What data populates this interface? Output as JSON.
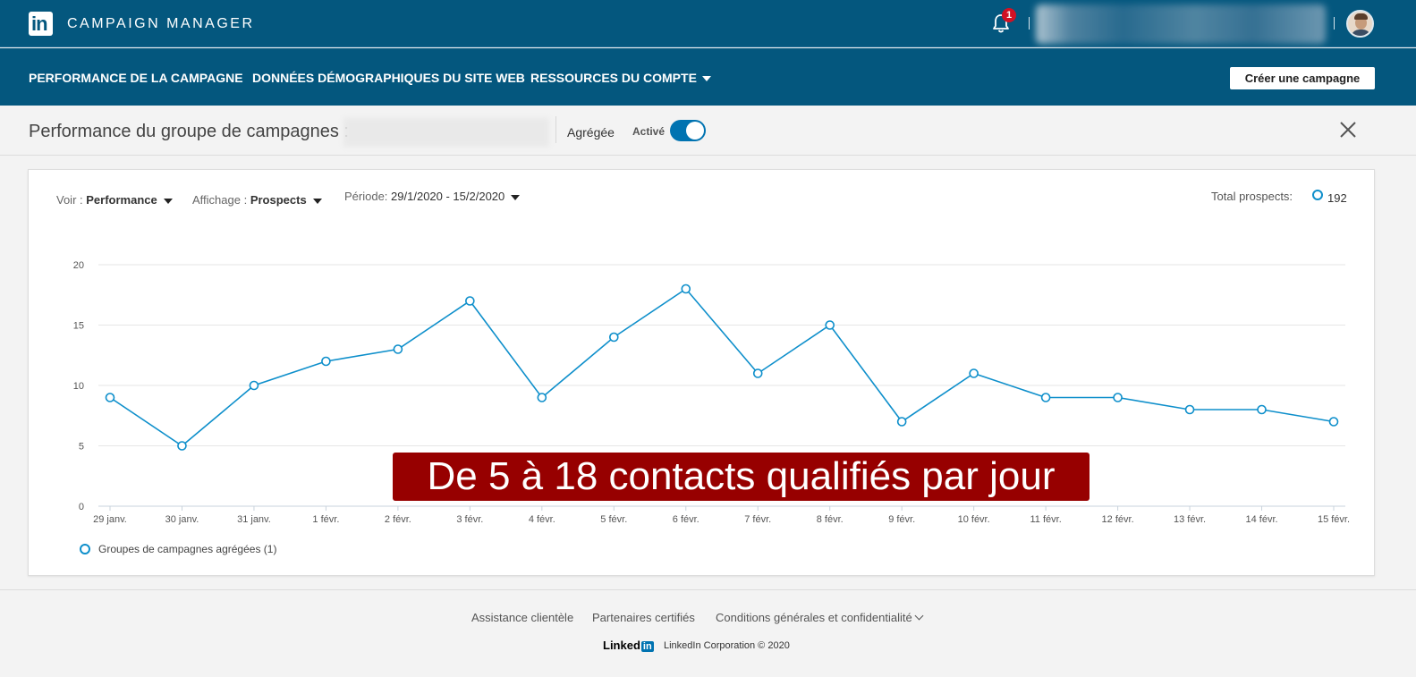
{
  "header": {
    "logo": "in",
    "title": "CAMPAIGN MANAGER",
    "notification_count": "1"
  },
  "nav": {
    "items": [
      "PERFORMANCE DE LA CAMPAGNE",
      "DONNÉES DÉMOGRAPHIQUES DU SITE WEB",
      "RESSOURCES DU COMPTE"
    ],
    "create_button": "Créer une campagne"
  },
  "subheader": {
    "title": "Performance du groupe de campagnes :",
    "aggregate_label": "Agrégée",
    "active_label": "Activé",
    "toggle_on": true
  },
  "controls": {
    "view_label": "Voir : ",
    "view_value": "Performance",
    "display_label": "Affichage : ",
    "display_value": "Prospects",
    "period_label": "Période: ",
    "period_value": "29/1/2020 - 15/2/2020",
    "total_label": "Total prospects:",
    "total_value": "192"
  },
  "chart_data": {
    "type": "line",
    "categories": [
      "29 janv.",
      "30 janv.",
      "31 janv.",
      "1 févr.",
      "2 févr.",
      "3 févr.",
      "4 févr.",
      "5 févr.",
      "6 févr.",
      "7 févr.",
      "8 févr.",
      "9 févr.",
      "10 févr.",
      "11 févr.",
      "12 févr.",
      "13 févr.",
      "14 févr.",
      "15 févr."
    ],
    "series": [
      {
        "name": "Groupes de campagnes agrégées (1)",
        "values": [
          9,
          5,
          10,
          12,
          13,
          17,
          9,
          14,
          18,
          11,
          15,
          7,
          11,
          9,
          9,
          8,
          8,
          7
        ]
      }
    ],
    "yticks": [
      0,
      5,
      10,
      15,
      20
    ],
    "ylim": [
      0,
      20
    ],
    "grid": true,
    "legend_position": "bottom-left",
    "color": "#0e8fcb"
  },
  "overlay": {
    "text": "De 5 à 18 contacts qualifiés par jour",
    "color": "#970000"
  },
  "footer": {
    "links": [
      "Assistance clientèle",
      "Partenaires certifiés",
      "Conditions générales et confidentialité"
    ],
    "brand_word": "Linked",
    "brand_box": "in",
    "copyright": "LinkedIn Corporation © 2020"
  }
}
